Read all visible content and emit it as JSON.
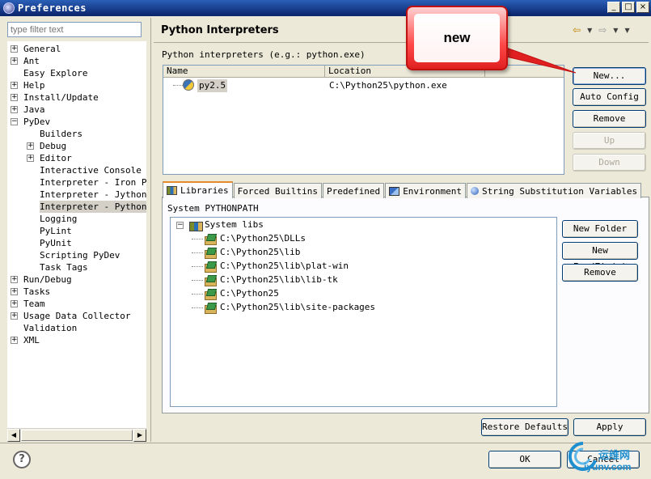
{
  "window": {
    "title": "Preferences",
    "controls": [
      "_",
      "□",
      "×"
    ]
  },
  "left": {
    "filter_placeholder": "type filter text",
    "tree": [
      {
        "label": "General",
        "expander": "+"
      },
      {
        "label": "Ant",
        "expander": "+"
      },
      {
        "label": "Easy Explore",
        "expander": ""
      },
      {
        "label": "Help",
        "expander": "+"
      },
      {
        "label": "Install/Update",
        "expander": "+"
      },
      {
        "label": "Java",
        "expander": "+"
      },
      {
        "label": "PyDev",
        "expander": "−"
      },
      {
        "label": "Builders",
        "expander": ""
      },
      {
        "label": "Debug",
        "expander": "+"
      },
      {
        "label": "Editor",
        "expander": "+"
      },
      {
        "label": "Interactive Console",
        "expander": ""
      },
      {
        "label": "Interpreter - Iron Py",
        "expander": ""
      },
      {
        "label": "Interpreter - Jython",
        "expander": ""
      },
      {
        "label": "Interpreter - Python",
        "expander": "",
        "selected": true
      },
      {
        "label": "Logging",
        "expander": ""
      },
      {
        "label": "PyLint",
        "expander": ""
      },
      {
        "label": "PyUnit",
        "expander": ""
      },
      {
        "label": "Scripting PyDev",
        "expander": ""
      },
      {
        "label": "Task Tags",
        "expander": ""
      },
      {
        "label": "Run/Debug",
        "expander": "+"
      },
      {
        "label": "Tasks",
        "expander": "+"
      },
      {
        "label": "Team",
        "expander": "+"
      },
      {
        "label": "Usage Data Collector",
        "expander": "+"
      },
      {
        "label": "Validation",
        "expander": ""
      },
      {
        "label": "XML",
        "expander": "+"
      }
    ]
  },
  "page": {
    "title": "Python Interpreters",
    "interpreters_label": "Python interpreters (e.g.: python.exe)",
    "columns": [
      "Name",
      "Location"
    ],
    "rows": [
      {
        "name": "py2.5",
        "location": "C:\\Python25\\python.exe"
      }
    ],
    "buttons": {
      "new": "New...",
      "auto_config": "Auto Config",
      "remove": "Remove",
      "up": "Up",
      "down": "Down"
    },
    "tabs": [
      {
        "label": "Libraries",
        "icon": "libraries-icon",
        "active": true
      },
      {
        "label": "Forced Builtins",
        "icon": "",
        "active": false
      },
      {
        "label": "Predefined",
        "icon": "",
        "active": false
      },
      {
        "label": "Environment",
        "icon": "environment-icon",
        "active": false
      },
      {
        "label": "String Substitution Variables",
        "icon": "variables-icon",
        "active": false
      }
    ],
    "system_pythonpath_label": "System PYTHONPATH",
    "libraries": {
      "root": "System libs",
      "root_expander": "−",
      "items": [
        "C:\\Python25\\DLLs",
        "C:\\Python25\\lib",
        "C:\\Python25\\lib\\plat-win",
        "C:\\Python25\\lib\\lib-tk",
        "C:\\Python25",
        "C:\\Python25\\lib\\site-packages"
      ]
    },
    "lib_buttons": {
      "new_folder": "New Folder",
      "new_egg": "New Egg/Zip(s)",
      "remove": "Remove"
    },
    "restore_defaults": "Restore Defaults",
    "apply": "Apply"
  },
  "footer": {
    "help": "?",
    "ok": "OK",
    "cancel": "Cancel"
  },
  "annotation": {
    "text": "new"
  },
  "watermark": {
    "line1": "运维网",
    "line2": "iyunv.com"
  }
}
